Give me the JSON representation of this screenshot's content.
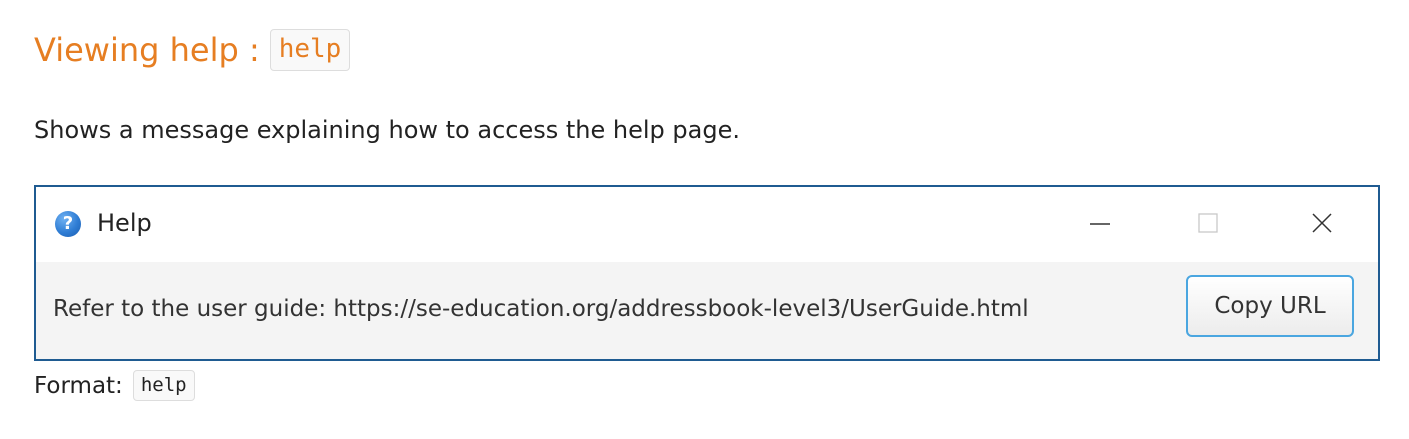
{
  "heading": {
    "text": "Viewing help :",
    "code": "help"
  },
  "intro": "Shows a message explaining how to access the help page.",
  "help_window": {
    "title": "Help",
    "guide_text": "Refer to the user guide: https://se-education.org/addressbook-level3/UserGuide.html",
    "copy_button_label": "Copy URL",
    "icons": {
      "title_icon": "help-icon",
      "minimize": "minimize-icon",
      "maximize": "maximize-icon",
      "close": "close-icon"
    }
  },
  "format": {
    "label": "Format:",
    "code": "help"
  },
  "colors": {
    "heading": "#e67e22",
    "window_border": "#1f5b91",
    "button_border": "#4aa6e0"
  }
}
